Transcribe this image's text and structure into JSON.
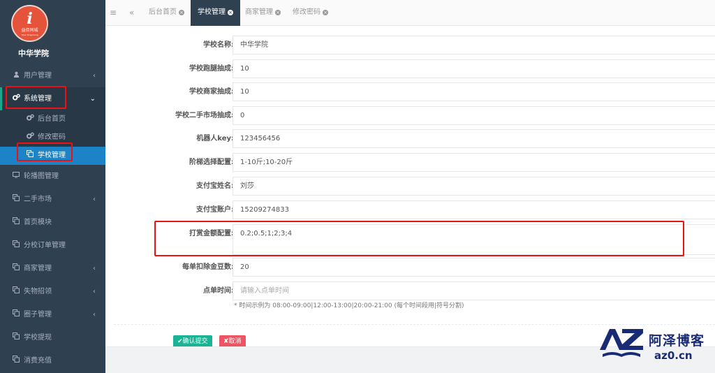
{
  "sidebar": {
    "logo": {
      "glyph": "i",
      "sub": "益佰同城",
      "sub2": "Yibai Tongcheng"
    },
    "school_name": "中华学院",
    "items": [
      {
        "label": "用户管理",
        "icon": "user-icon",
        "has_chevron": true
      },
      {
        "label": "系统管理",
        "icon": "gears-icon",
        "open": true
      },
      {
        "label": "轮播图管理",
        "icon": "desktop-icon"
      },
      {
        "label": "二手市场",
        "icon": "copy-icon",
        "has_chevron": true
      },
      {
        "label": "首页模块",
        "icon": "copy-icon"
      },
      {
        "label": "分校订单管理",
        "icon": "copy-icon"
      },
      {
        "label": "商家管理",
        "icon": "copy-icon",
        "has_chevron": true
      },
      {
        "label": "失物招领",
        "icon": "copy-icon",
        "has_chevron": true
      },
      {
        "label": "圈子管理",
        "icon": "copy-icon",
        "has_chevron": true
      },
      {
        "label": "学校提现",
        "icon": "copy-icon"
      },
      {
        "label": "消费充值",
        "icon": "copy-icon"
      }
    ],
    "sub_items": [
      {
        "label": "后台首页",
        "icon": "gears-icon"
      },
      {
        "label": "修改密码",
        "icon": "gears-icon"
      },
      {
        "label": "学校管理",
        "icon": "copy-icon",
        "active": true
      }
    ],
    "chevron_right": "‹",
    "chevron_down": "⌄"
  },
  "tabbar": {
    "menu_icon": "≡",
    "back_icon": "«",
    "tabs": [
      {
        "label": "后台首页"
      },
      {
        "label": "学校管理",
        "active": true
      },
      {
        "label": "商家管理"
      },
      {
        "label": "修改密码"
      }
    ],
    "close_glyph": "×"
  },
  "form": {
    "fields": [
      {
        "label": "学校名称:",
        "value": "中华学院"
      },
      {
        "label": "学校跑腿抽成:",
        "value": "10"
      },
      {
        "label": "学校商家抽成:",
        "value": "10"
      },
      {
        "label": "学校二手市场抽成:",
        "value": "0"
      },
      {
        "label": "机器人key:",
        "value": "123456456"
      },
      {
        "label": "阶梯选择配置:",
        "value": "1-10斤;10-20斤"
      },
      {
        "label": "支付宝姓名:",
        "value": "刘莎"
      },
      {
        "label": "支付宝账户:",
        "value": "15209274833"
      },
      {
        "label": "打赏金额配置:",
        "value": "0.2;0.5;1;2;3;4"
      },
      {
        "label": "每单扣除金豆数:",
        "value": "20"
      },
      {
        "label": "点单时间:",
        "value": "",
        "placeholder": "请输入点单时间"
      }
    ],
    "hint": "* 时间示例为 08:00-09:00|12:00-13:00|20:00-21:00 (每个时间段用|符号分割)",
    "submit_label": "✔确认提交",
    "cancel_label": "✘取消"
  },
  "watermark": {
    "mark": "AZ",
    "title": "阿泽博客",
    "url": "az0.cn",
    "color": "#1a2b75"
  },
  "colors": {
    "sidebar_bg": "#2f4050",
    "active_blue": "#1c84c6",
    "submit_green": "#1ab394",
    "cancel_red": "#ed5565",
    "highlight_red": "#ee1111"
  }
}
